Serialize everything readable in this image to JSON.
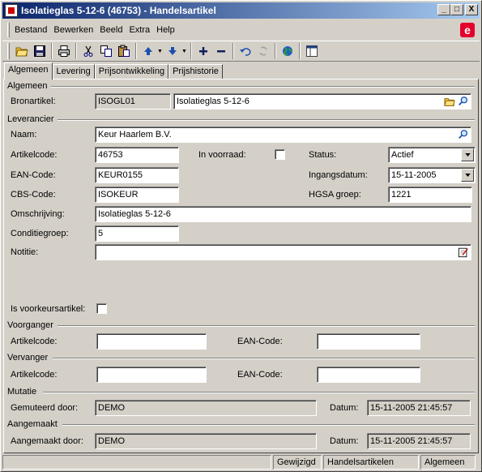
{
  "window": {
    "title": "Isolatieglas 5-12-6 (46753) - Handelsartikel",
    "buttons": [
      "_",
      "□",
      "X"
    ]
  },
  "menu": [
    "Bestand",
    "Bewerken",
    "Beeld",
    "Extra",
    "Help"
  ],
  "brand": {
    "logo_letter": "e",
    "color": "#e4002b"
  },
  "toolbar": {
    "icons": [
      "open-folder-icon",
      "save-icon",
      "print-icon",
      "cut-icon",
      "copy-icon",
      "paste-icon",
      "arrow-up-icon",
      "arrow-down-icon",
      "add-icon",
      "remove-icon",
      "undo-icon",
      "refresh-icon",
      "globe-icon",
      "layout-icon"
    ]
  },
  "tabs": [
    {
      "label": "Algemeen",
      "active": true
    },
    {
      "label": "Levering",
      "active": false
    },
    {
      "label": "Prijsontwikkeling",
      "active": false
    },
    {
      "label": "Prijshistorie",
      "active": false
    }
  ],
  "algemeen": {
    "section": "Algemeen",
    "bronartikel_label": "Bronartikel:",
    "bronartikel_code": "ISOGL01",
    "bronartikel_name": "Isolatieglas 5-12-6"
  },
  "leverancier": {
    "section": "Leverancier",
    "naam_label": "Naam:",
    "naam": "Keur Haarlem B.V.",
    "artikelcode_label": "Artikelcode:",
    "artikelcode": "46753",
    "in_voorraad_label": "In voorraad:",
    "in_voorraad": false,
    "status_label": "Status:",
    "status": "Actief",
    "ean_label": "EAN-Code:",
    "ean": "KEUR0155",
    "ingangsdatum_label": "Ingangsdatum:",
    "ingangsdatum": "15-11-2005",
    "cbs_label": "CBS-Code:",
    "cbs": "ISOKEUR",
    "hgsa_label": "HGSA groep:",
    "hgsa": "1221",
    "omschrijving_label": "Omschrijving:",
    "omschrijving": "Isolatieglas 5-12-6",
    "conditiegroep_label": "Conditiegroep:",
    "conditiegroep": "5",
    "notitie_label": "Notitie:",
    "notitie": ""
  },
  "voorkeur": {
    "label": "Is voorkeursartikel:",
    "checked": false
  },
  "voorganger": {
    "section": "Voorganger",
    "artikelcode_label": "Artikelcode:",
    "artikelcode": "",
    "ean_label": "EAN-Code:",
    "ean": ""
  },
  "vervanger": {
    "section": "Vervanger",
    "artikelcode_label": "Artikelcode:",
    "artikelcode": "",
    "ean_label": "EAN-Code:",
    "ean": ""
  },
  "mutatie": {
    "section": "Mutatie",
    "door_label": "Gemuteerd door:",
    "door": "DEMO",
    "datum_label": "Datum:",
    "datum": "15-11-2005 21:45:57"
  },
  "aangemaakt": {
    "section": "Aangemaakt",
    "door_label": "Aangemaakt door:",
    "door": "DEMO",
    "datum_label": "Datum:",
    "datum": "15-11-2005 21:45:57"
  },
  "statusbar": [
    "",
    "Gewijzigd",
    "Handelsartikelen",
    "Algemeen"
  ]
}
